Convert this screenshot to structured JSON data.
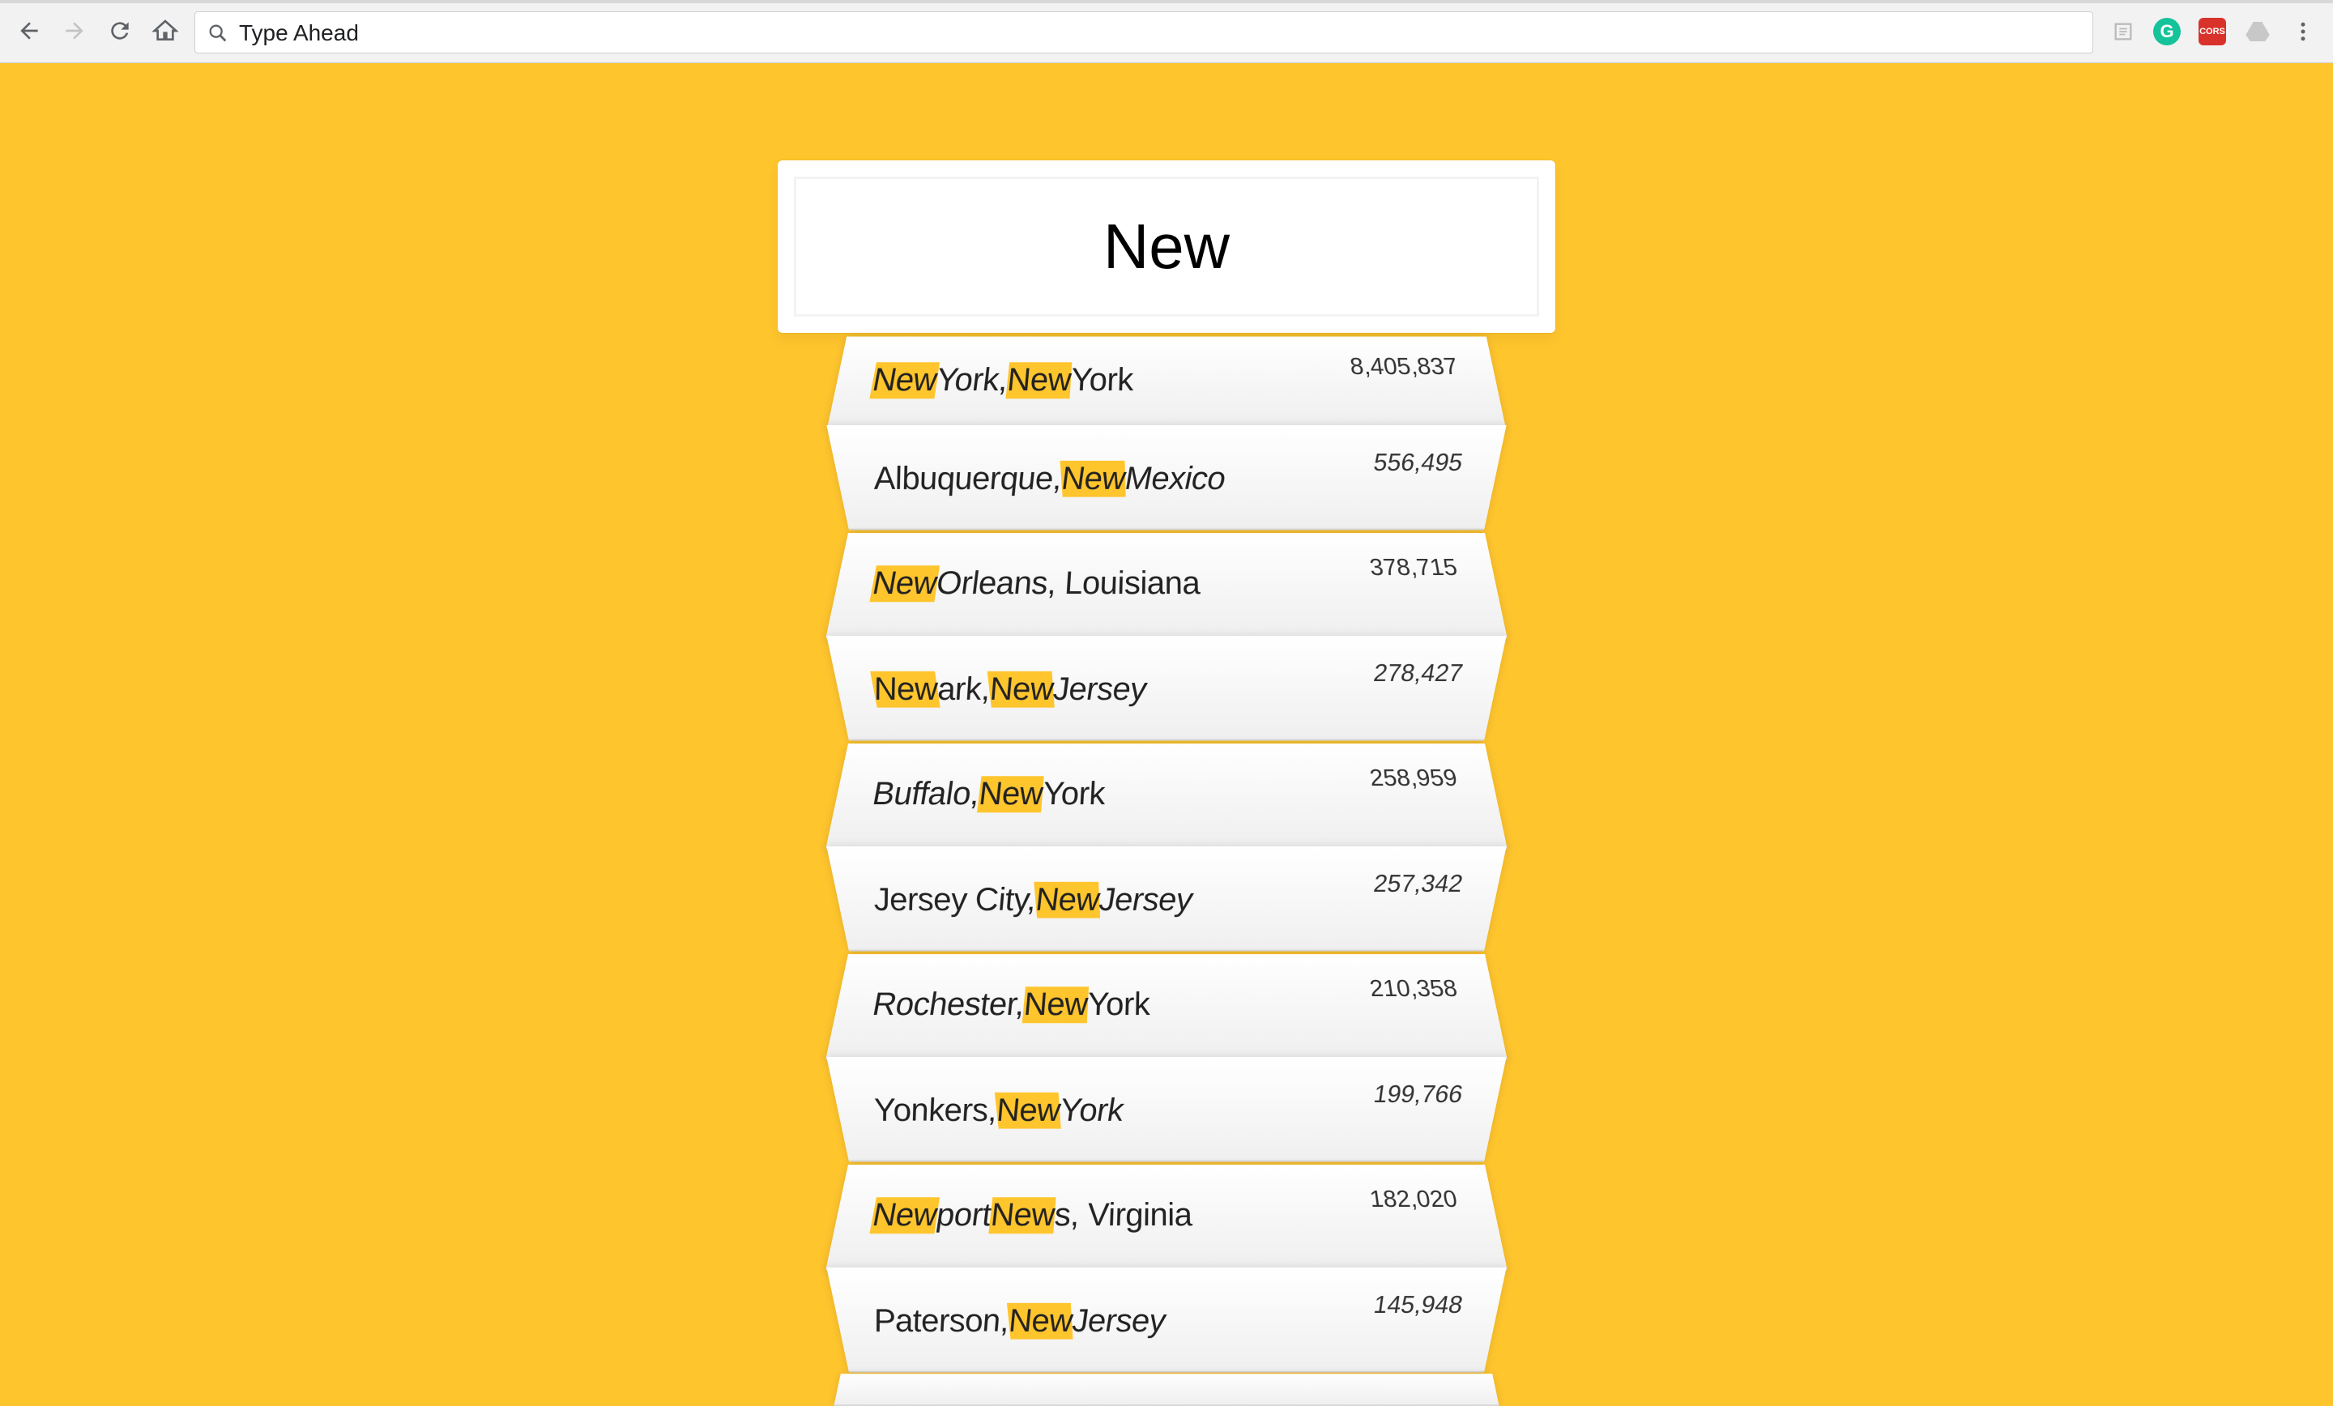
{
  "browser": {
    "address_text": "Type Ahead",
    "icons": [
      "back-arrow-icon",
      "forward-arrow-icon",
      "reload-icon",
      "home-icon",
      "search-icon",
      "reader-icon",
      "grammarly-icon",
      "cors-icon",
      "drive-icon",
      "menu-dots-icon"
    ],
    "grammarly_label": "G",
    "cors_label": "CORS"
  },
  "search": {
    "value": "New"
  },
  "colors": {
    "background": "#ffc52d",
    "highlight": "#ffc52d"
  },
  "suggestions": [
    {
      "parts": [
        {
          "t": "New",
          "hl": true
        },
        {
          "t": " York, ",
          "hl": false
        },
        {
          "t": "New",
          "hl": true
        },
        {
          "t": " York",
          "hl": false
        }
      ],
      "population": "8,405,837"
    },
    {
      "parts": [
        {
          "t": "Albuquerque, ",
          "hl": false
        },
        {
          "t": "New",
          "hl": true
        },
        {
          "t": " Mexico",
          "hl": false
        }
      ],
      "population": "556,495"
    },
    {
      "parts": [
        {
          "t": "New",
          "hl": true
        },
        {
          "t": " Orleans, Louisiana",
          "hl": false
        }
      ],
      "population": "378,715"
    },
    {
      "parts": [
        {
          "t": "New",
          "hl": true
        },
        {
          "t": "ark, ",
          "hl": false
        },
        {
          "t": "New",
          "hl": true
        },
        {
          "t": " Jersey",
          "hl": false
        }
      ],
      "population": "278,427"
    },
    {
      "parts": [
        {
          "t": "Buffalo, ",
          "hl": false
        },
        {
          "t": "New",
          "hl": true
        },
        {
          "t": " York",
          "hl": false
        }
      ],
      "population": "258,959"
    },
    {
      "parts": [
        {
          "t": "Jersey City, ",
          "hl": false
        },
        {
          "t": "New",
          "hl": true
        },
        {
          "t": " Jersey",
          "hl": false
        }
      ],
      "population": "257,342"
    },
    {
      "parts": [
        {
          "t": "Rochester, ",
          "hl": false
        },
        {
          "t": "New",
          "hl": true
        },
        {
          "t": " York",
          "hl": false
        }
      ],
      "population": "210,358"
    },
    {
      "parts": [
        {
          "t": "Yonkers, ",
          "hl": false
        },
        {
          "t": "New",
          "hl": true
        },
        {
          "t": " York",
          "hl": false
        }
      ],
      "population": "199,766"
    },
    {
      "parts": [
        {
          "t": "New",
          "hl": true
        },
        {
          "t": "port ",
          "hl": false
        },
        {
          "t": "New",
          "hl": true
        },
        {
          "t": "s, Virginia",
          "hl": false
        }
      ],
      "population": "182,020"
    },
    {
      "parts": [
        {
          "t": "Paterson, ",
          "hl": false
        },
        {
          "t": "New",
          "hl": true
        },
        {
          "t": " Jersey",
          "hl": false
        }
      ],
      "population": "145,948"
    }
  ]
}
